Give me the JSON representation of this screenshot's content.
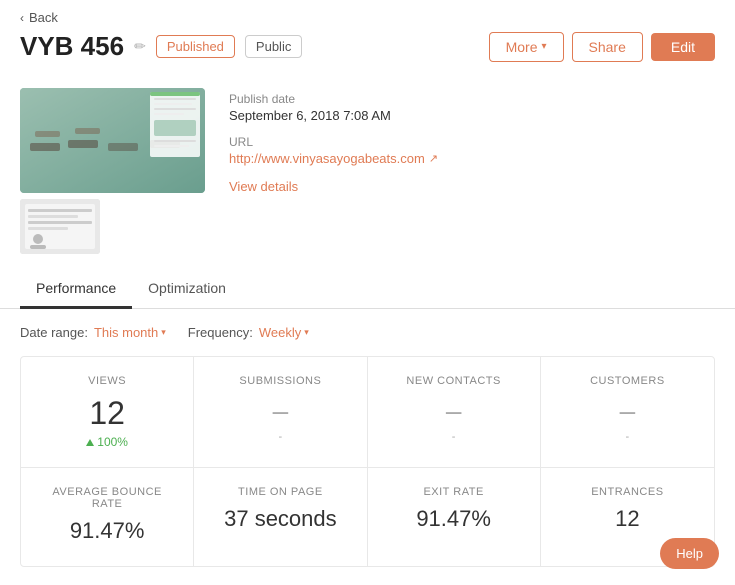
{
  "nav": {
    "back_label": "Back"
  },
  "header": {
    "title": "VYB 456",
    "status_badge": "Published",
    "visibility_badge": "Public",
    "btn_more": "More",
    "btn_share": "Share",
    "btn_edit": "Edit"
  },
  "metadata": {
    "publish_date_label": "Publish date",
    "publish_date_value": "September 6, 2018 7:08 AM",
    "url_label": "URL",
    "url_value": "http://www.vinyasayogabeats.com",
    "view_details_label": "View details"
  },
  "tabs": [
    {
      "id": "performance",
      "label": "Performance",
      "active": true
    },
    {
      "id": "optimization",
      "label": "Optimization",
      "active": false
    }
  ],
  "performance": {
    "date_range_label": "Date range:",
    "date_range_value": "This month",
    "frequency_label": "Frequency:",
    "frequency_value": "Weekly",
    "stats": [
      {
        "header": "VIEWS",
        "value": "12",
        "change": "100%",
        "sub": null,
        "is_number": true
      },
      {
        "header": "SUBMISSIONS",
        "value": "–",
        "change": null,
        "sub": "-",
        "is_number": false
      },
      {
        "header": "NEW CONTACTS",
        "value": "–",
        "change": null,
        "sub": "-",
        "is_number": false
      },
      {
        "header": "CUSTOMERS",
        "value": "–",
        "change": null,
        "sub": "-",
        "is_number": false
      }
    ],
    "stats_bottom": [
      {
        "header": "AVERAGE BOUNCE RATE",
        "value": "91.47%"
      },
      {
        "header": "TIME ON PAGE",
        "value": "37 seconds"
      },
      {
        "header": "EXIT RATE",
        "value": "91.47%"
      },
      {
        "header": "ENTRANCES",
        "value": "12"
      }
    ]
  },
  "help": {
    "label": "Help"
  }
}
